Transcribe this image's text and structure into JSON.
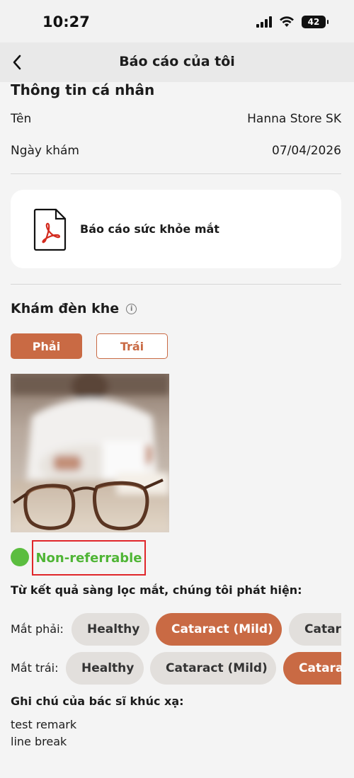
{
  "status_bar": {
    "time": "10:27",
    "battery": "42"
  },
  "nav": {
    "title": "Báo cáo của tôi",
    "back_icon": "chevron-left-icon"
  },
  "personal": {
    "section_title": "Thông tin cá nhân",
    "rows": [
      {
        "label": "Tên",
        "value": "Hanna Store SK"
      },
      {
        "label": "Ngày khám",
        "value": "07/04/2026"
      }
    ]
  },
  "report_card": {
    "label": "Báo cáo sức khỏe mắt",
    "icon": "pdf-file-icon"
  },
  "slit_lamp": {
    "title": "Khám đèn khe",
    "info_icon": "info-icon",
    "tabs": [
      {
        "label": "Phải",
        "active": true
      },
      {
        "label": "Trái",
        "active": false
      }
    ]
  },
  "result": {
    "status": "Non-referrable",
    "status_color": "#5bbd3f"
  },
  "findings": {
    "title": "Từ kết quả sàng lọc mắt, chúng tôi phát hiện:",
    "right_eye": {
      "label": "Mắt phải:",
      "chips": [
        "Healthy",
        "Cataract (Mild)",
        "Cataract"
      ]
    },
    "left_eye": {
      "label": "Mắt trái:",
      "chips": [
        "Healthy",
        "Cataract (Mild)",
        "Cataract"
      ]
    }
  },
  "doctor_note": {
    "title": "Ghi chú của bác sĩ khúc xạ:",
    "lines": [
      "test remark",
      "line break"
    ]
  },
  "colors": {
    "accent": "#c96a44",
    "success": "#5bbd3f",
    "highlight_border": "#e0262a"
  }
}
